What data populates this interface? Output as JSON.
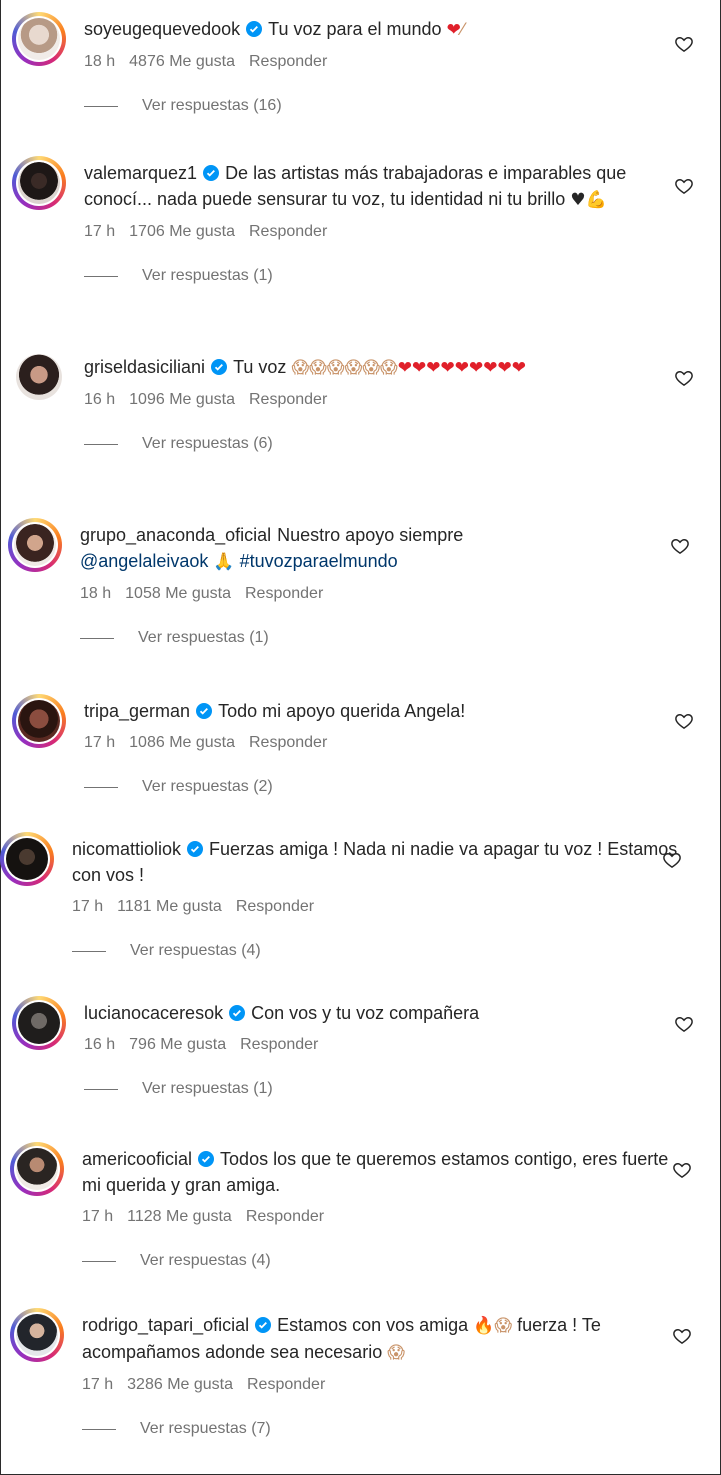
{
  "likes_label": "Me gusta",
  "reply_label": "Responder",
  "view_replies_label": "Ver respuestas",
  "colors": {
    "text": "#262626",
    "secondary": "#737373",
    "link": "#00376b",
    "verified": "#0095f6",
    "heart_red": "#e0202a"
  },
  "comments": [
    {
      "username": "soyeugequevedook",
      "verified": true,
      "text": "Tu voz para el mundo",
      "emojis": [
        "red-heart",
        "adhesive-bandage"
      ],
      "time": "18 h",
      "likes": "4876",
      "replies": "(16)"
    },
    {
      "username": "valemarquez1",
      "verified": true,
      "text": "De las artistas más trabajadoras e imparables que conocí... nada puede sensurar tu voz, tu identidad ni tu brillo",
      "emojis": [
        "black-heart",
        "flexed-biceps"
      ],
      "time": "17 h",
      "likes": "1706",
      "replies": "(1)"
    },
    {
      "username": "griseldasiciliani",
      "verified": true,
      "text": "Tu voz",
      "emojis": [
        "screaming-face x6",
        "red-heart x9"
      ],
      "time": "16 h",
      "likes": "1096",
      "replies": "(6)"
    },
    {
      "username": "grupo_anaconda_oficial",
      "verified": false,
      "text": "Nuestro apoyo siempre",
      "mention": "@angelaleivaok",
      "hashtag": "#tuvozparaelmundo",
      "emojis": [
        "folded-hands"
      ],
      "time": "18 h",
      "likes": "1058",
      "replies": "(1)"
    },
    {
      "username": "tripa_german",
      "verified": true,
      "text": "Todo mi apoyo querida Angela!",
      "time": "17 h",
      "likes": "1086",
      "replies": "(2)"
    },
    {
      "username": "nicomattioliok",
      "verified": true,
      "text": "Fuerzas amiga ! Nada ni nadie va apagar tu voz ! Estamos con vos !",
      "time": "17 h",
      "likes": "1181",
      "replies": "(4)"
    },
    {
      "username": "lucianocaceresok",
      "verified": true,
      "text": "Con vos y tu voz compañera",
      "time": "16 h",
      "likes": "796",
      "replies": "(1)"
    },
    {
      "username": "americooficial",
      "verified": true,
      "text": "Todos los que te queremos estamos contigo, eres fuerte mi querida y gran amiga.",
      "time": "17 h",
      "likes": "1128",
      "replies": "(4)"
    },
    {
      "username": "rodrigo_tapari_oficial",
      "verified": true,
      "text": "Estamos con vos amiga",
      "text2": "fuerza ! Te acompañamos adonde sea necesario",
      "emojis": [
        "fire",
        "screaming-face"
      ],
      "time": "17 h",
      "likes": "3286",
      "replies": "(7)"
    }
  ]
}
